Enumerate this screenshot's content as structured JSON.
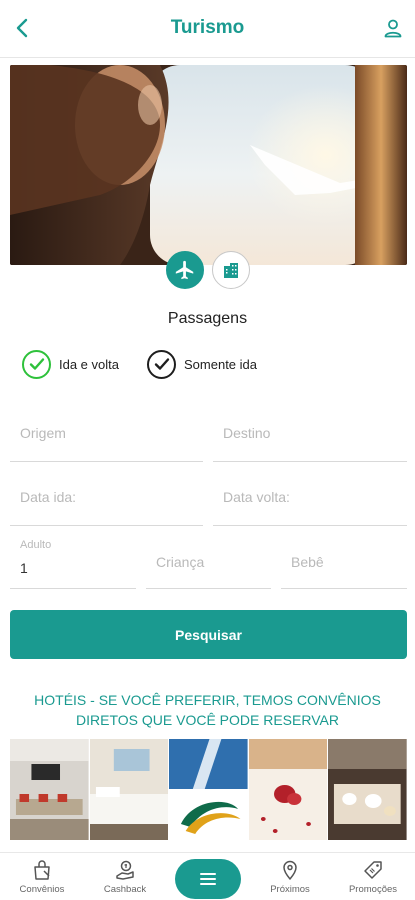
{
  "header": {
    "title": "Turismo",
    "back_icon": "chevron-left-icon",
    "user_icon": "user-icon"
  },
  "hero": {
    "description_icon": "airplane-window-photo"
  },
  "modes": [
    {
      "icon": "airplane-icon",
      "selected": true
    },
    {
      "icon": "hotel-building-icon",
      "selected": false
    }
  ],
  "section_title": "Passagens",
  "trip_type": {
    "round_trip_label": "Ida e volta",
    "one_way_label": "Somente ida",
    "selected": "Ida e volta"
  },
  "fields": {
    "origem_placeholder": "Origem",
    "destino_placeholder": "Destino",
    "data_ida_placeholder": "Data ida:",
    "data_volta_placeholder": "Data volta:",
    "adulto_label": "Adulto",
    "adulto_value": "1",
    "crianca_placeholder": "Criança",
    "bebe_placeholder": "Bebê"
  },
  "search_button": "Pesquisar",
  "promo": {
    "line1": "HOTÉIS - SE VOCÊ PREFERIR, TEMOS CONVÊNIOS",
    "line2": "DIRETOS QUE VOCÊ PODE RESERVAR"
  },
  "bottom_nav": {
    "convenios": "Convênios",
    "cashback": "Cashback",
    "proximos": "Próximos",
    "promocoes": "Promoções",
    "menu_icon": "hamburger-menu-icon"
  },
  "colors": {
    "accent": "#1a9a90",
    "check_green": "#2ec13b"
  }
}
